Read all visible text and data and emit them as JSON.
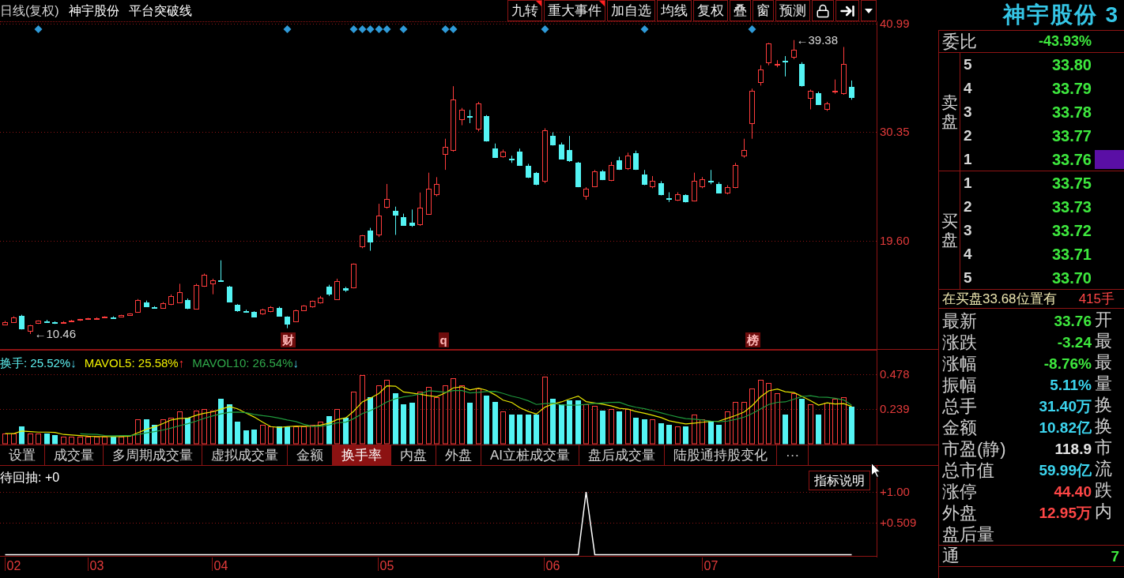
{
  "header": {
    "period": "日线(复权)",
    "stock": "神宇股份",
    "indicator": "平台突破线"
  },
  "toolbar": [
    {
      "kind": "text",
      "label": "九转",
      "flagged": true
    },
    {
      "kind": "text",
      "label": "重大事件",
      "flagged": true
    },
    {
      "kind": "text",
      "label": "加自选",
      "flagged": false
    },
    {
      "kind": "text",
      "label": "均线",
      "flagged": false
    },
    {
      "kind": "text",
      "label": "复权",
      "flagged": false
    },
    {
      "kind": "text",
      "label": "叠",
      "flagged": false
    },
    {
      "kind": "text",
      "label": "窗",
      "flagged": false
    },
    {
      "kind": "text",
      "label": "预测",
      "flagged": false
    },
    {
      "kind": "lock",
      "flagged": false
    },
    {
      "kind": "exit",
      "flagged": false
    },
    {
      "kind": "menu",
      "flagged": false
    }
  ],
  "main_chart": {
    "chart_data": [
      {
        "type": "candlestick",
        "ylim": [
          8.944,
          41.145
        ],
        "yticks": [
          {
            "value": 40.99,
            "label": "40.99"
          },
          {
            "value": 30.35,
            "label": "30.35"
          },
          {
            "value": 19.6,
            "label": "19.60"
          }
        ],
        "annotations": [
          "←39.38",
          "←10.46"
        ],
        "marker": "diamond",
        "categories": [
          null,
          null,
          null,
          null,
          null,
          null,
          null,
          null,
          null,
          null,
          null,
          null,
          null,
          null,
          null,
          null,
          null,
          null,
          null,
          null,
          null,
          null,
          null,
          null,
          null,
          null,
          null,
          null,
          null,
          null,
          null,
          null,
          null,
          null,
          "财",
          null,
          null,
          null,
          null,
          null,
          null,
          null,
          null,
          null,
          null,
          null,
          null,
          null,
          null,
          null,
          null,
          null,
          null,
          "q",
          null,
          null,
          null,
          null,
          null,
          null,
          null,
          null,
          null,
          null,
          null,
          null,
          null,
          null,
          null,
          null,
          null,
          null,
          null,
          null,
          null,
          null,
          null,
          null,
          null,
          null,
          null,
          null,
          null,
          null,
          null,
          null,
          null,
          null,
          null,
          null,
          "榜",
          null,
          null,
          null,
          null,
          null,
          null,
          null,
          null,
          null,
          null,
          null,
          null
        ],
        "ohlc": [
          [
            11.45,
            11.75,
            11.35,
            11.65
          ],
          [
            11.6,
            12.2,
            11.55,
            12.1
          ],
          [
            12.25,
            12.35,
            10.9,
            11.0
          ],
          [
            10.75,
            11.35,
            10.46,
            11.3
          ],
          [
            11.55,
            11.8,
            11.45,
            11.75
          ],
          [
            11.7,
            11.85,
            11.55,
            11.68
          ],
          [
            11.6,
            11.7,
            11.45,
            11.58
          ],
          [
            11.55,
            11.72,
            11.5,
            11.65
          ],
          [
            11.7,
            11.85,
            11.65,
            11.78
          ],
          [
            11.82,
            11.95,
            11.75,
            11.9
          ],
          [
            11.92,
            12.05,
            11.85,
            12.0
          ],
          [
            12.0,
            12.1,
            11.95,
            12.05
          ],
          [
            12.1,
            12.2,
            12.05,
            12.15
          ],
          [
            12.1,
            12.2,
            11.95,
            12.05
          ],
          [
            12.15,
            12.35,
            12.1,
            12.3
          ],
          [
            12.3,
            12.5,
            12.25,
            12.45
          ],
          [
            12.6,
            13.9,
            12.55,
            13.8
          ],
          [
            13.6,
            13.75,
            13.1,
            13.2
          ],
          [
            13.1,
            13.2,
            12.95,
            13.05
          ],
          [
            13.05,
            13.6,
            13.0,
            13.5
          ],
          [
            13.4,
            14.35,
            13.3,
            14.2
          ],
          [
            13.6,
            15.4,
            13.5,
            14.6
          ],
          [
            13.8,
            13.95,
            12.9,
            13.0
          ],
          [
            13.0,
            15.4,
            12.95,
            15.3
          ],
          [
            15.2,
            16.4,
            15.1,
            16.3
          ],
          [
            15.48,
            15.9,
            14.37,
            15.76
          ],
          [
            15.75,
            17.71,
            15.6,
            15.72
          ],
          [
            15.1,
            15.2,
            13.6,
            13.65
          ],
          [
            13.3,
            13.4,
            12.65,
            12.75
          ],
          [
            12.75,
            12.85,
            12.55,
            12.7
          ],
          [
            12.6,
            12.7,
            12.1,
            12.15
          ],
          [
            12.45,
            12.95,
            12.35,
            12.85
          ],
          [
            12.7,
            13.2,
            12.6,
            13.1
          ],
          [
            13.05,
            13.15,
            12.25,
            12.3
          ],
          [
            12.15,
            12.2,
            11.03,
            11.42
          ],
          [
            11.75,
            12.85,
            11.7,
            12.8
          ],
          [
            12.8,
            13.3,
            12.75,
            13.25
          ],
          [
            13.15,
            13.75,
            13.05,
            13.7
          ],
          [
            13.55,
            14.2,
            13.45,
            14.05
          ],
          [
            15.09,
            15.3,
            14.2,
            14.37
          ],
          [
            13.9,
            15.9,
            13.85,
            15.65
          ],
          [
            14.95,
            15.1,
            14.6,
            14.8
          ],
          [
            15.0,
            17.4,
            14.95,
            17.35
          ],
          [
            19.1,
            20.2,
            18.9,
            20.2
          ],
          [
            20.65,
            20.9,
            18.65,
            19.54
          ],
          [
            20.21,
            23.27,
            20.0,
            22.1
          ],
          [
            23.0,
            25.22,
            22.8,
            23.77
          ],
          [
            22.55,
            22.99,
            20.21,
            22.16
          ],
          [
            21.99,
            22.3,
            21.1,
            21.2
          ],
          [
            21.43,
            22.71,
            21.0,
            21.21
          ],
          [
            21.21,
            24.38,
            21.1,
            22.88
          ],
          [
            22.32,
            26.33,
            22.2,
            24.77
          ],
          [
            24.22,
            25.89,
            24.0,
            25.22
          ],
          [
            28.2,
            29.67,
            26.61,
            28.89
          ],
          [
            28.56,
            34.84,
            28.4,
            33.56
          ],
          [
            31.6,
            32.7,
            31.0,
            32.56
          ],
          [
            31.9,
            32.5,
            31.2,
            31.85
          ],
          [
            30.67,
            33.3,
            30.4,
            33.12
          ],
          [
            31.89,
            32.0,
            29.39,
            29.5
          ],
          [
            28.72,
            29.2,
            27.8,
            27.89
          ],
          [
            28.0,
            28.6,
            27.8,
            28.44
          ],
          [
            27.72,
            28.0,
            27.3,
            27.68
          ],
          [
            28.4,
            28.7,
            27.0,
            27.1
          ],
          [
            27.0,
            27.2,
            25.8,
            25.89
          ],
          [
            26.3,
            26.4,
            25.1,
            25.22
          ],
          [
            25.5,
            30.7,
            25.3,
            30.5
          ],
          [
            29.95,
            30.3,
            29.0,
            29.11
          ],
          [
            29.1,
            29.3,
            27.7,
            27.72
          ],
          [
            28.56,
            29.95,
            27.4,
            27.55
          ],
          [
            27.28,
            27.4,
            24.9,
            24.94
          ],
          [
            24.1,
            24.9,
            23.66,
            24.77
          ],
          [
            25.0,
            26.6,
            24.9,
            26.44
          ],
          [
            26.44,
            26.6,
            25.6,
            25.66
          ],
          [
            25.66,
            27.4,
            25.5,
            27.11
          ],
          [
            27.55,
            27.9,
            26.6,
            26.72
          ],
          [
            26.72,
            28.3,
            26.6,
            28.0
          ],
          [
            28.28,
            28.5,
            26.6,
            26.72
          ],
          [
            26.16,
            26.6,
            25.1,
            25.22
          ],
          [
            24.94,
            26.0,
            24.8,
            25.5
          ],
          [
            25.33,
            25.5,
            24.1,
            24.22
          ],
          [
            23.83,
            24.4,
            23.45,
            23.8
          ],
          [
            23.66,
            24.4,
            23.55,
            24.22
          ],
          [
            24.1,
            24.2,
            23.4,
            23.44
          ],
          [
            23.55,
            26.33,
            23.5,
            25.5
          ],
          [
            24.94,
            25.9,
            24.8,
            25.66
          ],
          [
            25.5,
            26.6,
            25.2,
            25.45
          ],
          [
            25.22,
            25.4,
            24.3,
            24.38
          ],
          [
            24.38,
            25.1,
            24.2,
            24.94
          ],
          [
            24.94,
            27.3,
            24.8,
            27.11
          ],
          [
            28.0,
            29.67,
            27.8,
            28.56
          ],
          [
            31.23,
            34.6,
            29.67,
            34.4
          ],
          [
            35.23,
            36.9,
            34.9,
            36.46
          ],
          [
            37.18,
            39.1,
            36.9,
            39.02
          ],
          [
            36.95,
            37.4,
            36.7,
            37.01
          ],
          [
            37.3,
            37.8,
            35.8,
            37.25
          ],
          [
            37.74,
            39.38,
            37.5,
            38.46
          ],
          [
            37.01,
            37.2,
            34.8,
            34.95
          ],
          [
            33.67,
            34.5,
            32.56,
            34.4
          ],
          [
            34.12,
            34.3,
            33.0,
            33.01
          ],
          [
            32.56,
            33.3,
            32.4,
            33.12
          ],
          [
            34.3,
            35.5,
            34.1,
            34.4
          ],
          [
            34.12,
            38.7,
            34.0,
            37.0
          ],
          [
            34.8,
            35.4,
            33.51,
            33.76
          ]
        ],
        "series": [
          {
            "type": "scatter",
            "color": "#2f9ad8",
            "values": [
              null,
              null,
              null,
              null,
              40.45,
              null,
              null,
              null,
              null,
              null,
              null,
              null,
              null,
              null,
              null,
              null,
              null,
              null,
              null,
              null,
              null,
              null,
              null,
              null,
              null,
              null,
              null,
              null,
              null,
              null,
              null,
              null,
              null,
              null,
              40.45,
              null,
              null,
              null,
              null,
              null,
              null,
              null,
              40.45,
              40.45,
              40.45,
              40.45,
              40.45,
              null,
              40.45,
              null,
              null,
              null,
              null,
              40.45,
              40.45,
              null,
              null,
              null,
              null,
              null,
              null,
              null,
              null,
              null,
              null,
              40.45,
              null,
              null,
              null,
              null,
              null,
              null,
              null,
              null,
              null,
              null,
              null,
              40.45,
              null,
              null,
              null,
              null,
              null,
              null,
              null,
              null,
              null,
              null,
              null,
              null,
              40.45,
              null,
              null,
              null,
              null,
              null,
              null,
              null,
              null,
              null,
              null,
              null,
              null
            ]
          }
        ]
      }
    ]
  },
  "volume_pane": {
    "legend": [
      {
        "text": "换手: 25.52%",
        "color": "#5ef0f0",
        "arrow": "↓",
        "rising": false
      },
      {
        "text": "MAVOL5: 25.58%",
        "color": "#f0f000",
        "arrow": "↑",
        "rising": true
      },
      {
        "text": "MAVOL10: 26.54%",
        "color": "#2fa84a",
        "arrow": "↓",
        "rising": false
      }
    ],
    "chart_data": [
      {
        "type": "bar",
        "ylim": [
          0,
          0.646
        ],
        "yticks": [
          {
            "value": 0.478,
            "label": "0.478"
          },
          {
            "value": 0.239,
            "label": "0.239"
          }
        ],
        "series": [
          {
            "type": "bar",
            "values": [
              0.07,
              0.07,
              0.12,
              0.07,
              0.07,
              0.07,
              0.06,
              0.05,
              0.05,
              0.05,
              0.05,
              0.05,
              0.05,
              0.05,
              0.05,
              0.06,
              0.17,
              0.17,
              0.13,
              0.17,
              0.18,
              0.22,
              0.18,
              0.23,
              0.24,
              0.23,
              0.31,
              0.27,
              0.15,
              0.09,
              0.1,
              0.13,
              0.12,
              0.12,
              0.12,
              0.12,
              0.12,
              0.13,
              0.15,
              0.19,
              0.24,
              0.18,
              0.36,
              0.47,
              0.32,
              0.4,
              0.44,
              0.35,
              0.27,
              0.28,
              0.36,
              0.39,
              0.32,
              0.4,
              0.45,
              0.4,
              0.28,
              0.38,
              0.33,
              0.29,
              0.22,
              0.2,
              0.2,
              0.2,
              0.2,
              0.46,
              0.31,
              0.27,
              0.3,
              0.3,
              0.27,
              0.26,
              0.23,
              0.24,
              0.22,
              0.24,
              0.18,
              0.17,
              0.17,
              0.14,
              0.13,
              0.12,
              0.12,
              0.2,
              0.17,
              0.16,
              0.13,
              0.22,
              0.29,
              0.29,
              0.38,
              0.44,
              0.42,
              0.35,
              0.2,
              0.35,
              0.31,
              0.27,
              0.2,
              0.28,
              0.31,
              0.32,
              0.255
            ],
            "colors": [
              "#ff3c3c",
              "#ff3c3c",
              "#54f4f4",
              "#ff3c3c",
              "#ff3c3c",
              "#54f4f4",
              "#54f4f4",
              "#ff3c3c",
              "#ff3c3c",
              "#ff3c3c",
              "#ff3c3c",
              "#ff3c3c",
              "#ff3c3c",
              "#54f4f4",
              "#ff3c3c",
              "#ff3c3c",
              "#ff3c3c",
              "#54f4f4",
              "#54f4f4",
              "#ff3c3c",
              "#ff3c3c",
              "#ff3c3c",
              "#54f4f4",
              "#ff3c3c",
              "#ff3c3c",
              "#ff3c3c",
              "#54f4f4",
              "#54f4f4",
              "#54f4f4",
              "#54f4f4",
              "#54f4f4",
              "#ff3c3c",
              "#ff3c3c",
              "#54f4f4",
              "#54f4f4",
              "#ff3c3c",
              "#ff3c3c",
              "#ff3c3c",
              "#ff3c3c",
              "#54f4f4",
              "#ff3c3c",
              "#54f4f4",
              "#ff3c3c",
              "#ff3c3c",
              "#54f4f4",
              "#ff3c3c",
              "#ff3c3c",
              "#54f4f4",
              "#54f4f4",
              "#54f4f4",
              "#ff3c3c",
              "#ff3c3c",
              "#ff3c3c",
              "#ff3c3c",
              "#ff3c3c",
              "#ff3c3c",
              "#54f4f4",
              "#ff3c3c",
              "#54f4f4",
              "#54f4f4",
              "#ff3c3c",
              "#54f4f4",
              "#54f4f4",
              "#54f4f4",
              "#54f4f4",
              "#ff3c3c",
              "#54f4f4",
              "#54f4f4",
              "#54f4f4",
              "#54f4f4",
              "#ff3c3c",
              "#ff3c3c",
              "#54f4f4",
              "#ff3c3c",
              "#54f4f4",
              "#ff3c3c",
              "#54f4f4",
              "#54f4f4",
              "#ff3c3c",
              "#54f4f4",
              "#54f4f4",
              "#ff3c3c",
              "#54f4f4",
              "#ff3c3c",
              "#ff3c3c",
              "#54f4f4",
              "#54f4f4",
              "#ff3c3c",
              "#ff3c3c",
              "#ff3c3c",
              "#ff3c3c",
              "#ff3c3c",
              "#ff3c3c",
              "#ff3c3c",
              "#54f4f4",
              "#ff3c3c",
              "#54f4f4",
              "#ff3c3c",
              "#54f4f4",
              "#ff3c3c",
              "#ff3c3c",
              "#ff3c3c",
              "#54f4f4"
            ]
          },
          {
            "type": "line",
            "color": "#e8e800",
            "values": [
              0.07,
              0.07,
              0.087,
              0.083,
              0.08,
              0.08,
              0.078,
              0.064,
              0.06,
              0.056,
              0.052,
              0.05,
              0.05,
              0.05,
              0.05,
              0.052,
              0.076,
              0.1,
              0.116,
              0.14,
              0.164,
              0.174,
              0.176,
              0.196,
              0.21,
              0.22,
              0.238,
              0.256,
              0.24,
              0.21,
              0.184,
              0.148,
              0.118,
              0.112,
              0.118,
              0.122,
              0.12,
              0.122,
              0.128,
              0.142,
              0.166,
              0.178,
              0.224,
              0.288,
              0.314,
              0.346,
              0.398,
              0.396,
              0.356,
              0.348,
              0.34,
              0.33,
              0.324,
              0.35,
              0.384,
              0.392,
              0.37,
              0.382,
              0.368,
              0.336,
              0.3,
              0.284,
              0.248,
              0.222,
              0.204,
              0.252,
              0.274,
              0.288,
              0.308,
              0.328,
              0.29,
              0.28,
              0.272,
              0.26,
              0.244,
              0.238,
              0.222,
              0.21,
              0.196,
              0.18,
              0.158,
              0.146,
              0.136,
              0.142,
              0.148,
              0.154,
              0.156,
              0.176,
              0.194,
              0.218,
              0.262,
              0.324,
              0.364,
              0.376,
              0.358,
              0.352,
              0.326,
              0.296,
              0.266,
              0.282,
              0.274,
              0.276,
              0.256
            ]
          },
          {
            "type": "line",
            "color": "#1f9a3c",
            "values": [
              null,
              null,
              null,
              null,
              null,
              null,
              null,
              null,
              null,
              0.068,
              0.066,
              0.064,
              0.057,
              0.055,
              0.056,
              0.056,
              0.063,
              0.075,
              0.083,
              0.095,
              0.108,
              0.125,
              0.138,
              0.156,
              0.175,
              0.192,
              0.206,
              0.216,
              0.218,
              0.214,
              0.202,
              0.193,
              0.187,
              0.176,
              0.164,
              0.153,
              0.134,
              0.12,
              0.12,
              0.13,
              0.144,
              0.149,
              0.173,
              0.208,
              0.228,
              0.256,
              0.288,
              0.31,
              0.322,
              0.331,
              0.343,
              0.364,
              0.36,
              0.353,
              0.366,
              0.366,
              0.35,
              0.353,
              0.359,
              0.36,
              0.346,
              0.327,
              0.315,
              0.295,
              0.27,
              0.276,
              0.279,
              0.268,
              0.265,
              0.266,
              0.271,
              0.277,
              0.28,
              0.284,
              0.286,
              0.264,
              0.251,
              0.241,
              0.228,
              0.212,
              0.198,
              0.184,
              0.173,
              0.169,
              0.164,
              0.156,
              0.151,
              0.156,
              0.168,
              0.183,
              0.208,
              0.24,
              0.27,
              0.285,
              0.288,
              0.307,
              0.325,
              0.33,
              0.321,
              0.32,
              0.313,
              0.301,
              0.265
            ]
          }
        ]
      }
    ],
    "tabs": [
      {
        "label": "设置",
        "selected": false
      },
      {
        "label": "成交量",
        "selected": false
      },
      {
        "label": "多周期成交量",
        "selected": false
      },
      {
        "label": "虚拟成交量",
        "selected": false
      },
      {
        "label": "金额",
        "selected": false
      },
      {
        "label": "换手率",
        "selected": true
      },
      {
        "label": "内盘",
        "selected": false
      },
      {
        "label": "外盘",
        "selected": false
      },
      {
        "label": "AI立桩成交量",
        "selected": false
      },
      {
        "label": "盘后成交量",
        "selected": false
      },
      {
        "label": "陆股通持股变化",
        "selected": false
      },
      {
        "label": "···",
        "selected": false
      }
    ]
  },
  "signal_pane": {
    "label": "待回抽: +0",
    "help_button": "指标说明",
    "chart_data": [
      {
        "type": "line",
        "color": "#ffffff",
        "ylim": [
          -0.0261,
          1.428
        ],
        "yticks": [
          {
            "value": 1,
            "label": "+1.00"
          },
          {
            "value": 0.509,
            "label": "+0.509"
          }
        ],
        "categories": [
          null,
          "02",
          null,
          null,
          null,
          null,
          null,
          null,
          null,
          null,
          null,
          "03",
          null,
          null,
          null,
          null,
          null,
          null,
          null,
          null,
          null,
          null,
          null,
          null,
          null,
          null,
          "04",
          null,
          null,
          null,
          null,
          null,
          null,
          null,
          null,
          null,
          null,
          null,
          null,
          null,
          null,
          null,
          null,
          null,
          null,
          null,
          "05",
          null,
          null,
          null,
          null,
          null,
          null,
          null,
          null,
          null,
          null,
          null,
          null,
          null,
          null,
          null,
          null,
          null,
          null,
          null,
          "06",
          null,
          null,
          null,
          null,
          null,
          null,
          null,
          null,
          null,
          null,
          null,
          null,
          null,
          null,
          null,
          null,
          null,
          null,
          "07",
          null,
          null,
          null,
          null,
          null,
          null,
          null,
          null,
          null,
          null,
          null,
          null,
          null,
          null,
          null,
          null,
          null
        ],
        "values": [
          0,
          0,
          0,
          0,
          0,
          0,
          0,
          0,
          0,
          0,
          0,
          0,
          0,
          0,
          0,
          0,
          0,
          0,
          0,
          0,
          0,
          0,
          0,
          0,
          0,
          0,
          0,
          0,
          0,
          0,
          0,
          0,
          0,
          0,
          0,
          0,
          0,
          0,
          0,
          0,
          0,
          0,
          0,
          0,
          0,
          0,
          0,
          0,
          0,
          0,
          0,
          0,
          0,
          0,
          0,
          0,
          0,
          0,
          0,
          0,
          0,
          0,
          0,
          0,
          0,
          0,
          0,
          0,
          0,
          0,
          1,
          0,
          0,
          0,
          0,
          0,
          0,
          0,
          0,
          0,
          0,
          0,
          0,
          0,
          0,
          0,
          0,
          0,
          0,
          0,
          0,
          0,
          0,
          0,
          0,
          0,
          0,
          0,
          0,
          0,
          0,
          0,
          0
        ]
      }
    ]
  },
  "quote_panel": {
    "title": "神宇股份 3",
    "ratio": {
      "label": "委比",
      "value": "-43.93%"
    },
    "asks": {
      "label": "卖盘",
      "rows": [
        {
          "rank": "5",
          "price": "33.80",
          "highlighted": false
        },
        {
          "rank": "4",
          "price": "33.79",
          "highlighted": false
        },
        {
          "rank": "3",
          "price": "33.78",
          "highlighted": false
        },
        {
          "rank": "2",
          "price": "33.77",
          "highlighted": false
        },
        {
          "rank": "1",
          "price": "33.76",
          "highlighted": true
        }
      ]
    },
    "bids": {
      "label": "买盘",
      "rows": [
        {
          "rank": "1",
          "price": "33.75",
          "highlighted": false
        },
        {
          "rank": "2",
          "price": "33.73",
          "highlighted": false
        },
        {
          "rank": "3",
          "price": "33.72",
          "highlighted": false
        },
        {
          "rank": "4",
          "price": "33.71",
          "highlighted": false
        },
        {
          "rank": "5",
          "price": "33.70",
          "highlighted": false
        }
      ]
    },
    "notice": {
      "text": "在买盘33.68位置有",
      "quantity": "415手"
    },
    "stats": [
      {
        "label": "最新",
        "value": "33.76",
        "color": "#3ee83e",
        "side_label": "开"
      },
      {
        "label": "涨跌",
        "value": "-3.24",
        "color": "#3ee83e",
        "side_label": "最"
      },
      {
        "label": "涨幅",
        "value": "-8.76%",
        "color": "#3ee83e",
        "side_label": "最"
      },
      {
        "label": "振幅",
        "value": "5.11%",
        "color": "#3cd4ee",
        "side_label": "量"
      },
      {
        "label": "总手",
        "value": "31.40万",
        "color": "#3cd4ee",
        "side_label": "换"
      },
      {
        "label": "金额",
        "value": "10.82亿",
        "color": "#3cd4ee",
        "side_label": "换"
      },
      {
        "label": "市盈(静)",
        "value": "118.9",
        "color": "#e4e4e4",
        "side_label": "市"
      },
      {
        "label": "总市值",
        "value": "59.99亿",
        "color": "#3cd4ee",
        "side_label": "流"
      },
      {
        "label": "涨停",
        "value": "44.40",
        "color": "#ff4646",
        "side_label": "跌"
      },
      {
        "label": "外盘",
        "value": "12.95万",
        "color": "#ff4646",
        "side_label": "内"
      },
      {
        "label": "盘后量"
      }
    ],
    "footer": {
      "label": "通",
      "value": "7",
      "color": "#3ee83e"
    }
  }
}
